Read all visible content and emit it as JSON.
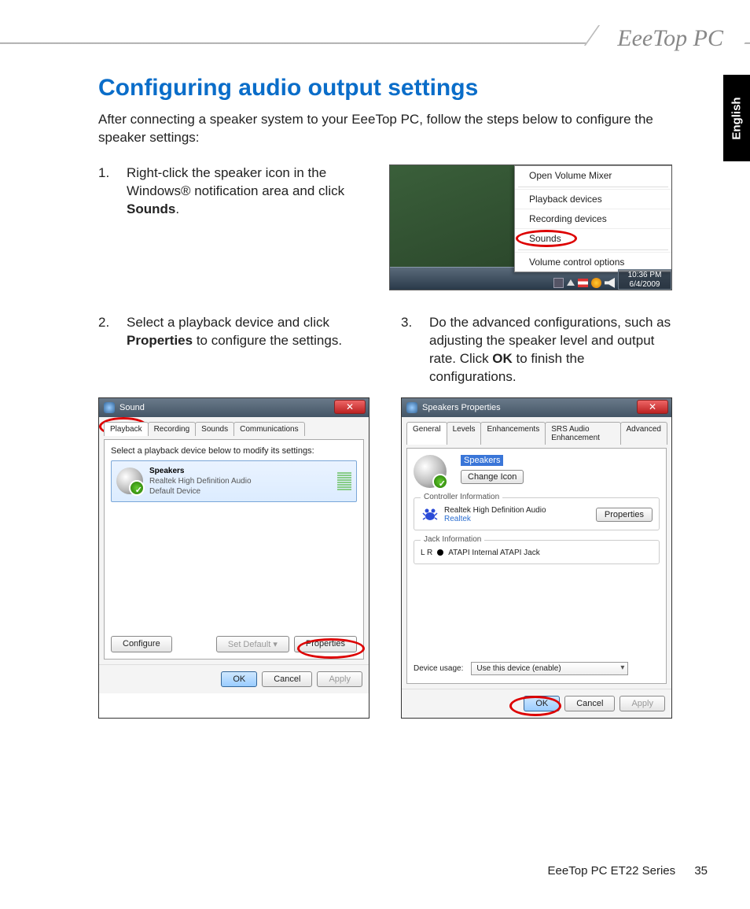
{
  "brand": "EeeTop PC",
  "languageTab": "English",
  "heading": "Configuring audio output settings",
  "intro": "After connecting a speaker system to your EeeTop PC, follow the steps below to configure the speaker settings:",
  "steps": {
    "s1": {
      "num": "1.",
      "pre": "Right-click the speaker icon in the Windows® notification area and click ",
      "bold": "Sounds",
      "post": "."
    },
    "s2": {
      "num": "2.",
      "pre": "Select a playback device and click ",
      "bold": "Properties",
      "post": " to configure the settings."
    },
    "s3": {
      "num": "3.",
      "pre": "Do the advanced configurations, such as adjusting the speaker level and output rate. Click ",
      "bold": "OK",
      "post": " to finish the configurations."
    }
  },
  "contextMenu": {
    "items": [
      "Open Volume Mixer",
      "Playback devices",
      "Recording devices",
      "Sounds",
      "Volume control options"
    ],
    "highlightIndex": 3,
    "clock": {
      "time": "10:36 PM",
      "date": "6/4/2009"
    }
  },
  "soundDialog": {
    "title": "Sound",
    "tabs": [
      "Playback",
      "Recording",
      "Sounds",
      "Communications"
    ],
    "activeTab": 0,
    "instruction": "Select a playback device below to modify its settings:",
    "device": {
      "name": "Speakers",
      "driver": "Realtek High Definition Audio",
      "status": "Default Device"
    },
    "buttons": {
      "configure": "Configure",
      "setDefault": "Set Default",
      "properties": "Properties",
      "ok": "OK",
      "cancel": "Cancel",
      "apply": "Apply"
    }
  },
  "propsDialog": {
    "title": "Speakers Properties",
    "tabs": [
      "General",
      "Levels",
      "Enhancements",
      "SRS Audio Enhancement",
      "Advanced"
    ],
    "activeTab": 0,
    "nameField": "Speakers",
    "changeIcon": "Change Icon",
    "controller": {
      "legend": "Controller Information",
      "name": "Realtek High Definition Audio",
      "vendor": "Realtek",
      "propBtn": "Properties"
    },
    "jack": {
      "legend": "Jack Information",
      "lr": "L R",
      "desc": "ATAPI Internal ATAPI Jack"
    },
    "usage": {
      "label": "Device usage:",
      "value": "Use this device (enable)"
    },
    "buttons": {
      "ok": "OK",
      "cancel": "Cancel",
      "apply": "Apply"
    }
  },
  "footer": {
    "series": "EeeTop PC ET22 Series",
    "page": "35"
  }
}
